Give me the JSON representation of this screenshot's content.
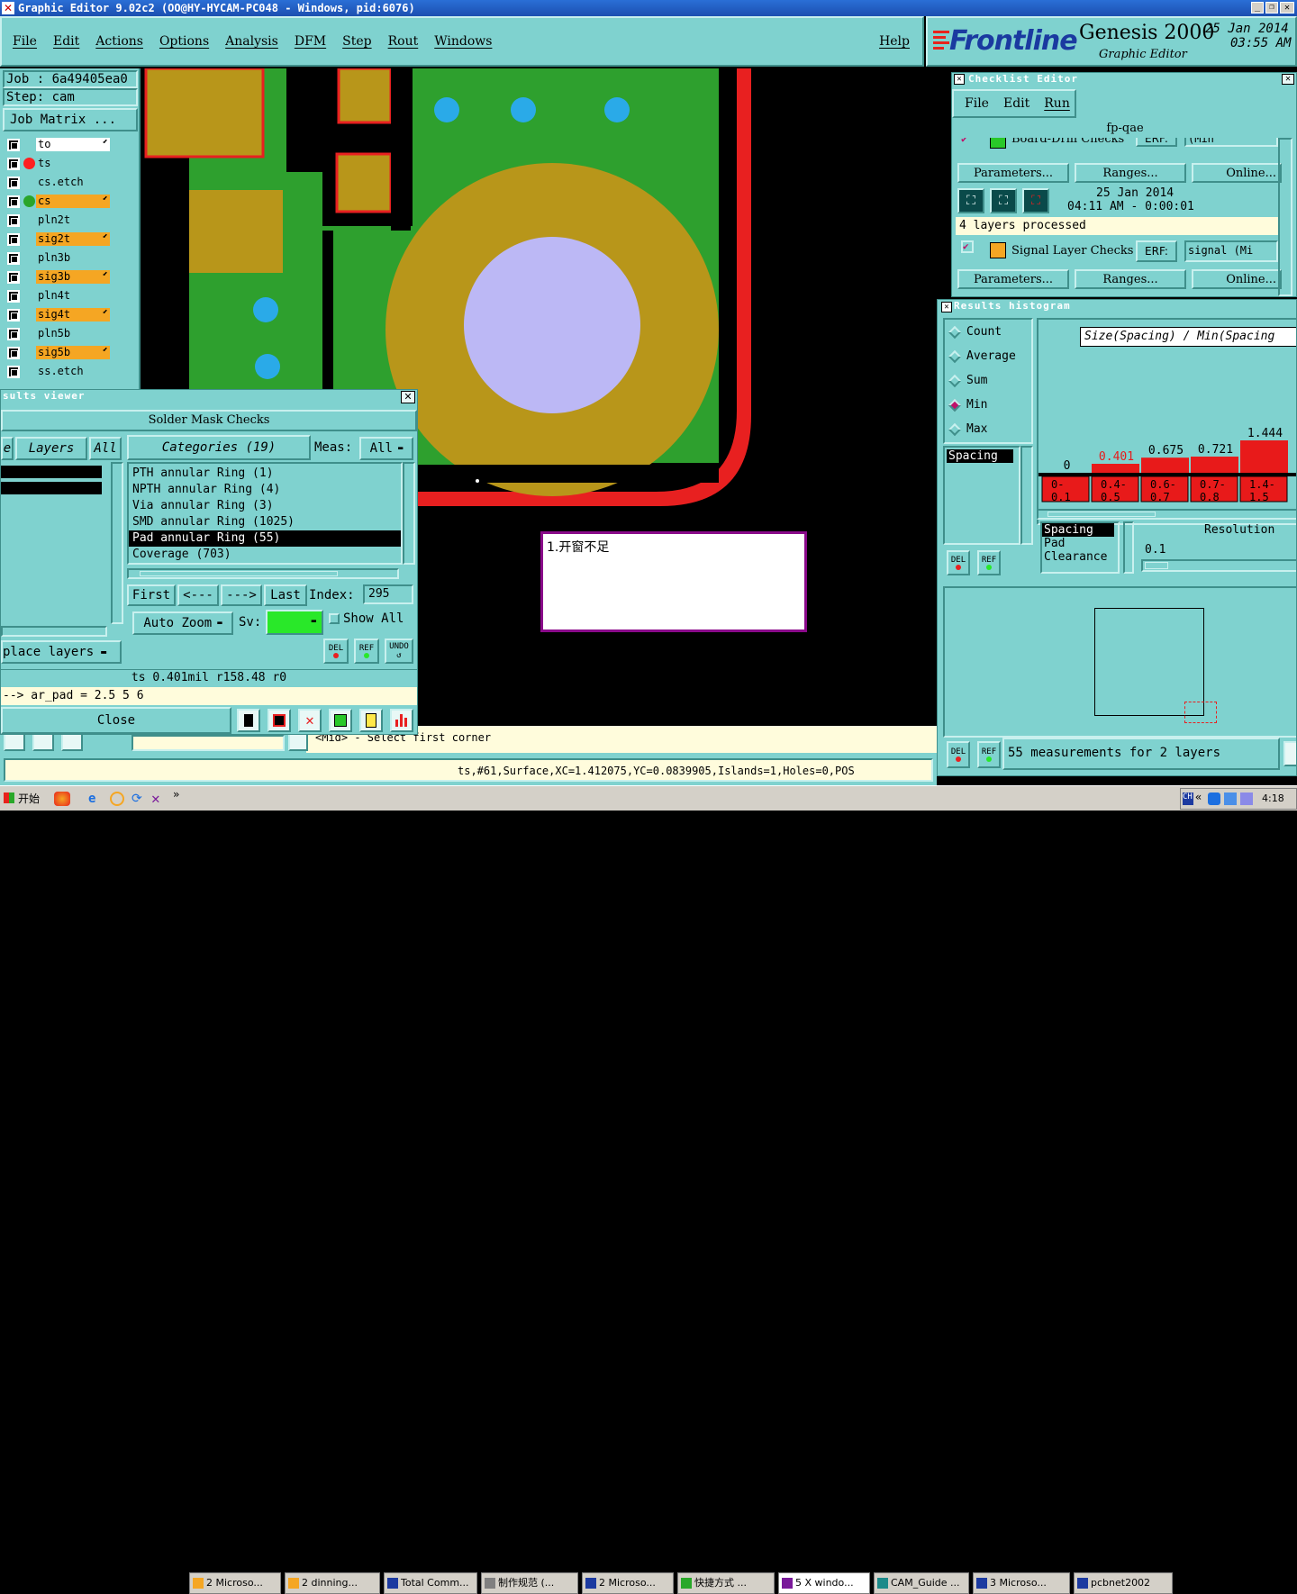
{
  "window": {
    "title": "Graphic Editor 9.02c2  (OO@HY-HYCAM-PC048 - Windows, pid:6076)"
  },
  "menubar": {
    "items": [
      "File",
      "Edit",
      "Actions",
      "Options",
      "Analysis",
      "DFM",
      "Step",
      "Rout",
      "Windows"
    ],
    "help": "Help"
  },
  "brand": {
    "logo": "Frontline",
    "product": "Genesis 2000",
    "subtitle": "Graphic Editor",
    "date": "25 Jan 2014",
    "time": "03:55 AM"
  },
  "job": {
    "job_label": "Job  :  6a49405ea0",
    "step_label": "Step:  cam",
    "matrix_button": "Job Matrix ..."
  },
  "layers": [
    {
      "name": "to",
      "color": "#ffffff",
      "dot": ""
    },
    {
      "name": "ts",
      "color": "#7fd2cf",
      "dot": "#ff2020"
    },
    {
      "name": "cs.etch",
      "color": "#7fd2cf",
      "dot": ""
    },
    {
      "name": "cs",
      "color": "#f5a623",
      "dot": "#2aa52a"
    },
    {
      "name": "pln2t",
      "color": "#7fd2cf",
      "dot": ""
    },
    {
      "name": "sig2t",
      "color": "#f5a623",
      "dot": ""
    },
    {
      "name": "pln3b",
      "color": "#7fd2cf",
      "dot": ""
    },
    {
      "name": "sig3b",
      "color": "#f5a623",
      "dot": ""
    },
    {
      "name": "pln4t",
      "color": "#7fd2cf",
      "dot": ""
    },
    {
      "name": "sig4t",
      "color": "#f5a623",
      "dot": ""
    },
    {
      "name": "pln5b",
      "color": "#7fd2cf",
      "dot": ""
    },
    {
      "name": "sig5b",
      "color": "#f5a623",
      "dot": ""
    },
    {
      "name": "ss.etch",
      "color": "#7fd2cf",
      "dot": ""
    }
  ],
  "results_viewer": {
    "title": "sults viewer",
    "header": "Solder Mask Checks",
    "layers_btn": "Layers",
    "all_btn": "All",
    "left_edge_label": "e",
    "categories_btn": "Categories (19)",
    "meas_label": "Meas:",
    "meas_value": "All",
    "categories": [
      "PTH annular Ring (1)",
      "NPTH annular Ring (4)",
      "Via annular Ring (3)",
      "SMD annular Ring (1025)",
      "Pad annular Ring (55)",
      "Coverage (703)"
    ],
    "selected_index": 4,
    "nav": {
      "first": "First",
      "prev": "<---",
      "next": "--->",
      "last": "Last",
      "index_label": "Index:",
      "index_value": "295"
    },
    "auto_zoom": "Auto Zoom",
    "sv_label": "Sv:",
    "show_all": "Show All",
    "place_layers": "place layers",
    "del": "DEL",
    "ref": "REF",
    "undo": "UNDO",
    "status_line": "ts 0.401mil   r158.48   r0",
    "pad_line": "--> ar_pad = 2.5 5 6",
    "close": "Close"
  },
  "canvas": {
    "annotation": "1.开窗不足",
    "prompt": "<Mid> - Select first corner",
    "coord_readout": "ts,#61,Surface,XC=1.412075,YC=0.0839905,Islands=1,Holes=0,POS"
  },
  "checklist_editor": {
    "title": "Checklist Editor",
    "menu": [
      "File",
      "Edit",
      "Run"
    ],
    "name": "fp-qae",
    "row1": {
      "label": "Board-Drill Checks",
      "erf": "ERF:",
      "erf_value": "(Min"
    },
    "buttons": [
      "Parameters...",
      "Ranges...",
      "Online..."
    ],
    "timestamp_date": "25 Jan 2014",
    "timestamp_time": "04:11 AM - 0:00:01",
    "processed": "4 layers processed",
    "row2": {
      "label": "Signal Layer Checks",
      "erf": "ERF:",
      "erf_value": "signal (Mi"
    }
  },
  "results_histogram": {
    "title": "Results histogram",
    "options": [
      "Count",
      "Average",
      "Sum",
      "Min",
      "Max"
    ],
    "selected_option": "Min",
    "list_item": "Spacing",
    "chart_title": "Size(Spacing) / Min(Spacing",
    "bins": [
      {
        "range_top": "0-",
        "range_bottom": "0.1",
        "value": "0"
      },
      {
        "range_top": "0.4-",
        "range_bottom": "0.5",
        "value": "0.401"
      },
      {
        "range_top": "0.6-",
        "range_bottom": "0.7",
        "value": "0.675"
      },
      {
        "range_top": "0.7-",
        "range_bottom": "0.8",
        "value": "0.721"
      },
      {
        "range_top": "1.4-",
        "range_bottom": "1.5",
        "value": "1.444"
      }
    ],
    "types": [
      "Spacing",
      "Pad",
      "Clearance"
    ],
    "resolution_label": "Resolution",
    "resolution_value": "0.1",
    "del": "DEL",
    "ref": "REF",
    "measurements": "55 measurements for 2 layers"
  },
  "taskbar": {
    "start": "开始",
    "items": [
      "2 Microso...",
      "2 dinning...",
      "Total Comm...",
      "制作规范 (...",
      "2 Microso...",
      "快捷方式 ...",
      "5 X windo...",
      "CAM_Guide ...",
      "3 Microso...",
      "pcbnet2002"
    ],
    "clock": "4:18"
  }
}
